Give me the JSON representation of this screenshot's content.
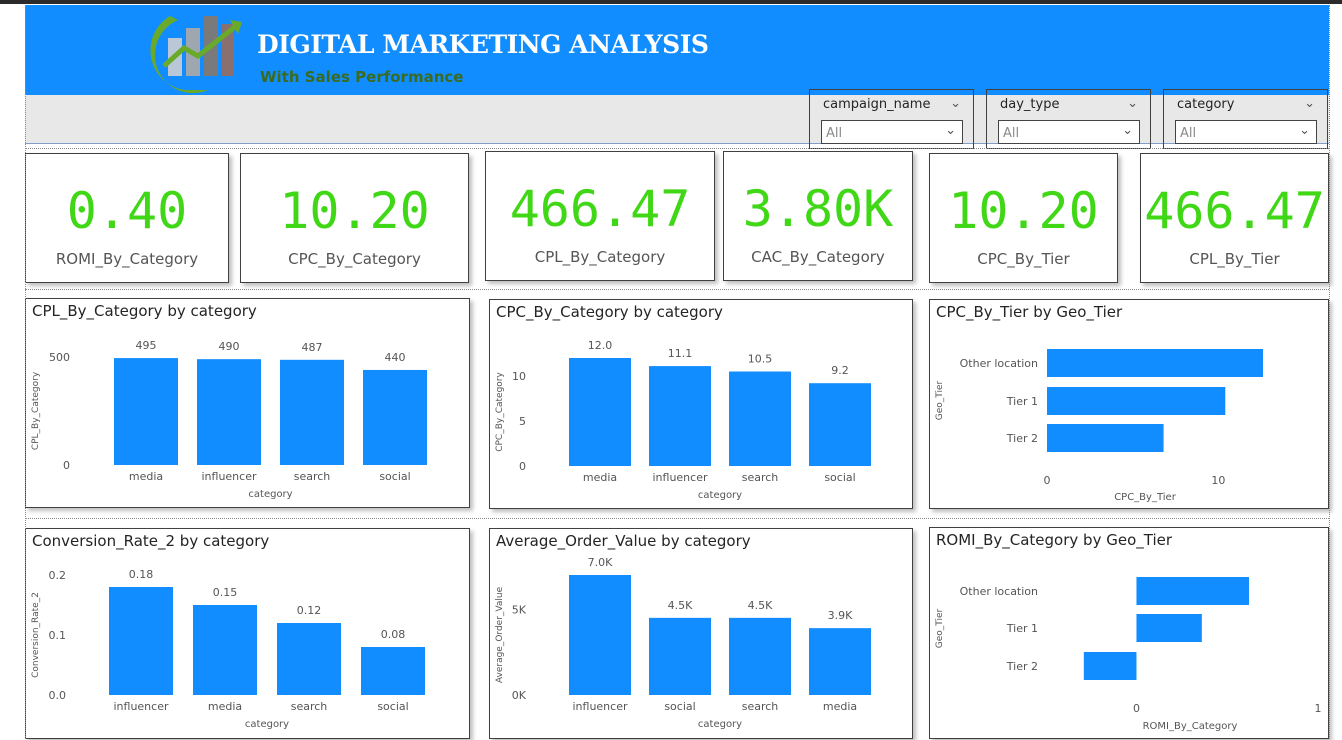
{
  "header": {
    "title": "DIGITAL MARKETING ANALYSIS",
    "subtitle": "With Sales Performance",
    "color": "#118dff"
  },
  "slicers": [
    {
      "label": "campaign_name",
      "value": "All"
    },
    {
      "label": "day_type",
      "value": "All"
    },
    {
      "label": "category",
      "value": "All"
    }
  ],
  "kpis": [
    {
      "value": "0.40",
      "name": "ROMI_By_Category"
    },
    {
      "value": "10.20",
      "name": "CPC_By_Category"
    },
    {
      "value": "466.47",
      "name": "CPL_By_Category"
    },
    {
      "value": "3.80K",
      "name": "CAC_By_Category"
    },
    {
      "value": "10.20",
      "name": "CPC_By_Tier"
    },
    {
      "value": "466.47",
      "name": "CPL_By_Tier"
    }
  ],
  "colors": {
    "bar": "#118dff",
    "kpi": "#40d716"
  },
  "chart_data": [
    {
      "type": "bar",
      "title": "CPL_By_Category by category",
      "xlabel": "category",
      "ylabel": "CPL_By_Category",
      "categories": [
        "media",
        "influencer",
        "search",
        "social"
      ],
      "values": [
        495,
        490,
        487,
        440
      ],
      "labels": [
        "495",
        "490",
        "487",
        "440"
      ],
      "ylim": [
        0,
        500
      ],
      "yticks": [
        0,
        500
      ],
      "ytick_labels": [
        "0",
        "500"
      ]
    },
    {
      "type": "bar",
      "title": "CPC_By_Category by category",
      "xlabel": "category",
      "ylabel": "CPC_By_Category",
      "categories": [
        "media",
        "influencer",
        "search",
        "social"
      ],
      "values": [
        12.0,
        11.1,
        10.5,
        9.2
      ],
      "labels": [
        "12.0",
        "11.1",
        "10.5",
        "9.2"
      ],
      "ylim": [
        0,
        12
      ],
      "yticks": [
        0,
        5,
        10
      ],
      "ytick_labels": [
        "0",
        "5",
        "10"
      ]
    },
    {
      "type": "bar",
      "orientation": "horizontal",
      "title": "CPC_By_Tier by Geo_Tier",
      "xlabel": "CPC_By_Tier",
      "ylabel": "Geo_Tier",
      "categories": [
        "Other location",
        "Tier 1",
        "Tier 2"
      ],
      "values": [
        12.6,
        10.4,
        6.8
      ],
      "xlim": [
        0,
        12.6
      ],
      "xticks": [
        0,
        10
      ],
      "xtick_labels": [
        "0",
        "10"
      ]
    },
    {
      "type": "bar",
      "title": "Conversion_Rate_2 by category",
      "xlabel": "category",
      "ylabel": "Conversion_Rate_2",
      "categories": [
        "influencer",
        "media",
        "search",
        "social"
      ],
      "values": [
        0.18,
        0.15,
        0.12,
        0.08
      ],
      "labels": [
        "0.18",
        "0.15",
        "0.12",
        "0.08"
      ],
      "ylim": [
        0,
        0.2
      ],
      "yticks": [
        0,
        0.1,
        0.2
      ],
      "ytick_labels": [
        "0.0",
        "0.1",
        "0.2"
      ]
    },
    {
      "type": "bar",
      "title": "Average_Order_Value by category",
      "xlabel": "category",
      "ylabel": "Average_Order_Value",
      "categories": [
        "influencer",
        "social",
        "search",
        "media"
      ],
      "values": [
        7000,
        4500,
        4500,
        3900
      ],
      "labels": [
        "7.0K",
        "4.5K",
        "4.5K",
        "3.9K"
      ],
      "ylim": [
        0,
        7000
      ],
      "yticks": [
        0,
        5000
      ],
      "ytick_labels": [
        "0K",
        "5K"
      ]
    },
    {
      "type": "bar",
      "orientation": "horizontal",
      "title": "ROMI_By_Category by Geo_Tier",
      "xlabel": "ROMI_By_Category",
      "ylabel": "Geo_Tier",
      "categories": [
        "Other location",
        "Tier 1",
        "Tier 2"
      ],
      "values": [
        0.62,
        0.36,
        -0.29
      ],
      "xlim": [
        -0.3,
        1
      ],
      "xticks": [
        0,
        1
      ],
      "xtick_labels": [
        "0",
        "1"
      ]
    }
  ]
}
